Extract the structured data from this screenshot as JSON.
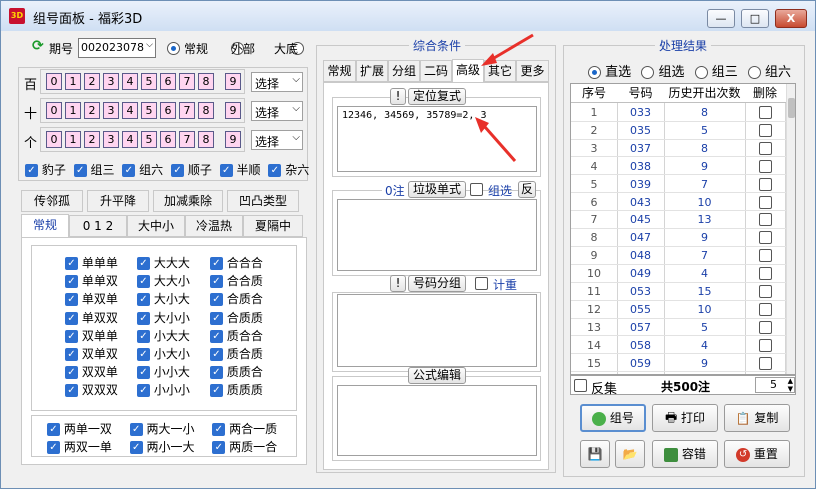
{
  "window": {
    "title": "组号面板 - 福彩3D",
    "app_icon": "3D",
    "minimize": "—",
    "maximize": "□",
    "close": "X"
  },
  "period": {
    "label": "期号",
    "value": "002023078",
    "modes": [
      "常规",
      "外部",
      "大底"
    ],
    "selected_mode": "常规"
  },
  "positions": [
    {
      "label": "百",
      "select": "选择"
    },
    {
      "label": "十",
      "select": "选择"
    },
    {
      "label": "个",
      "select": "选择"
    }
  ],
  "digits": [
    "0",
    "1",
    "2",
    "3",
    "4",
    "5",
    "6",
    "7",
    "8",
    "9"
  ],
  "types": [
    "豹子",
    "组三",
    "组六",
    "顺子",
    "半顺",
    "杂六"
  ],
  "left_tabs_row1": [
    "传邻孤",
    "升平降",
    "加减乘除",
    "凹凸类型"
  ],
  "left_tabs_row2": [
    "常规",
    "0 1 2",
    "大中小",
    "冷温热",
    "夏隔中"
  ],
  "left_checks": [
    [
      "单单单",
      "大大大",
      "合合合"
    ],
    [
      "单单双",
      "大大小",
      "合合质"
    ],
    [
      "单双单",
      "大小大",
      "合质合"
    ],
    [
      "单双双",
      "大小小",
      "合质质"
    ],
    [
      "双单单",
      "小大大",
      "质合合"
    ],
    [
      "双单双",
      "小大小",
      "质合质"
    ],
    [
      "双双单",
      "小小大",
      "质质合"
    ],
    [
      "双双双",
      "小小小",
      "质质质"
    ]
  ],
  "left_bottom_checks": [
    [
      "两单一双",
      "两大一小",
      "两合一质"
    ],
    [
      "两双一单",
      "两小一大",
      "两质一合"
    ]
  ],
  "middle": {
    "title": "综合条件",
    "tabs": [
      "常规",
      "扩展",
      "分组",
      "二码",
      "高级",
      "其它",
      "更多"
    ],
    "active_tab": "高级",
    "section1": {
      "bang": "!",
      "title": "定位复式",
      "content": "12346, 34569, 35789=2, 3"
    },
    "section2": {
      "count": "0注",
      "title": "垃圾单式",
      "check_label": "组选",
      "btn": "反"
    },
    "section3": {
      "bang": "!",
      "title": "号码分组",
      "check_label": "计重"
    },
    "section4": {
      "title": "公式编辑"
    }
  },
  "results": {
    "title": "处理结果",
    "modes": [
      "直选",
      "组选",
      "组三",
      "组六"
    ],
    "selected_mode": "直选",
    "columns": [
      "序号",
      "号码",
      "历史开出次数",
      "删除"
    ],
    "rows": [
      {
        "idx": "1",
        "num": "033",
        "count": "8"
      },
      {
        "idx": "2",
        "num": "035",
        "count": "5"
      },
      {
        "idx": "3",
        "num": "037",
        "count": "8"
      },
      {
        "idx": "4",
        "num": "038",
        "count": "9"
      },
      {
        "idx": "5",
        "num": "039",
        "count": "7"
      },
      {
        "idx": "6",
        "num": "043",
        "count": "10"
      },
      {
        "idx": "7",
        "num": "045",
        "count": "13"
      },
      {
        "idx": "8",
        "num": "047",
        "count": "9"
      },
      {
        "idx": "9",
        "num": "048",
        "count": "7"
      },
      {
        "idx": "10",
        "num": "049",
        "count": "4"
      },
      {
        "idx": "11",
        "num": "053",
        "count": "15"
      },
      {
        "idx": "12",
        "num": "055",
        "count": "10"
      },
      {
        "idx": "13",
        "num": "057",
        "count": "5"
      },
      {
        "idx": "14",
        "num": "058",
        "count": "4"
      },
      {
        "idx": "15",
        "num": "059",
        "count": "9"
      }
    ],
    "invert_label": "反集",
    "total": "共500注",
    "spinner_value": "5",
    "buttons": {
      "group": "组号",
      "print": "打印",
      "copy": "复制",
      "fault": "容错",
      "reset": "重置"
    }
  },
  "colors": {
    "digit_bg": "#ffd5f0",
    "check_blue": "#2d6fd0",
    "title_blue": "#1a3fa8",
    "arrow_red": "#e8302a"
  }
}
